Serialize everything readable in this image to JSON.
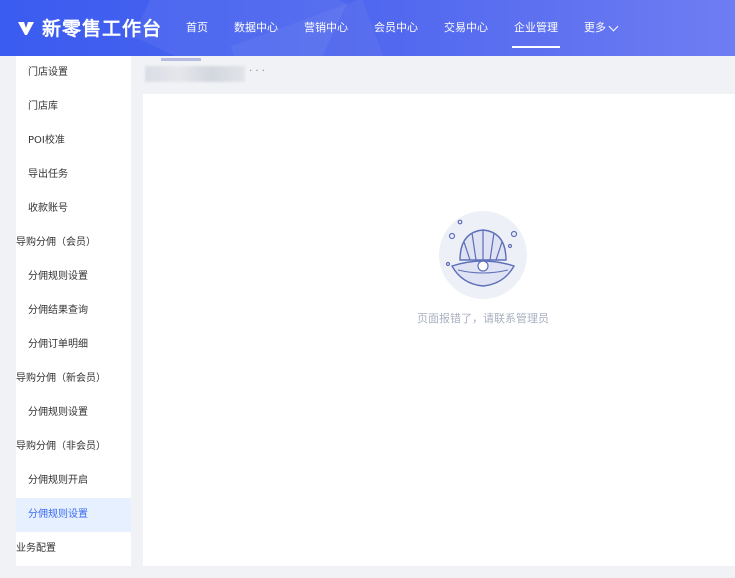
{
  "header": {
    "brand_title": "新零售工作台",
    "nav": [
      {
        "label": "首页"
      },
      {
        "label": "数据中心"
      },
      {
        "label": "营销中心"
      },
      {
        "label": "会员中心"
      },
      {
        "label": "交易中心"
      },
      {
        "label": "企业管理"
      },
      {
        "label": "更多"
      }
    ],
    "active_nav": "企业管理"
  },
  "sidebar": {
    "items": [
      {
        "label": "门店设置"
      },
      {
        "label": "门店库"
      },
      {
        "label": "POI校准"
      },
      {
        "label": "导出任务"
      },
      {
        "label": "收款账号"
      },
      {
        "label": "导购分佣（会员）"
      },
      {
        "label": "分佣规则设置"
      },
      {
        "label": "分佣结果查询"
      },
      {
        "label": "分佣订单明细"
      },
      {
        "label": "导购分佣（新会员）"
      },
      {
        "label": "分佣规则设置"
      },
      {
        "label": "导购分佣（非会员）"
      },
      {
        "label": "分佣规则开启"
      },
      {
        "label": "分佣规则设置"
      },
      {
        "label": "业务配置"
      }
    ],
    "active_label": "分佣规则设置"
  },
  "breadcrumb": {
    "trail": "· · ·"
  },
  "main": {
    "empty_message": "页面报错了，请联系管理员",
    "empty_icon": "shell-pearl-icon"
  },
  "colors": {
    "header_gradient_start": "#3b5cf0",
    "header_gradient_end": "#6e7df2",
    "active_bg": "#e6f0ff",
    "active_text": "#3b6cf0",
    "empty_text": "#aab0c0"
  }
}
